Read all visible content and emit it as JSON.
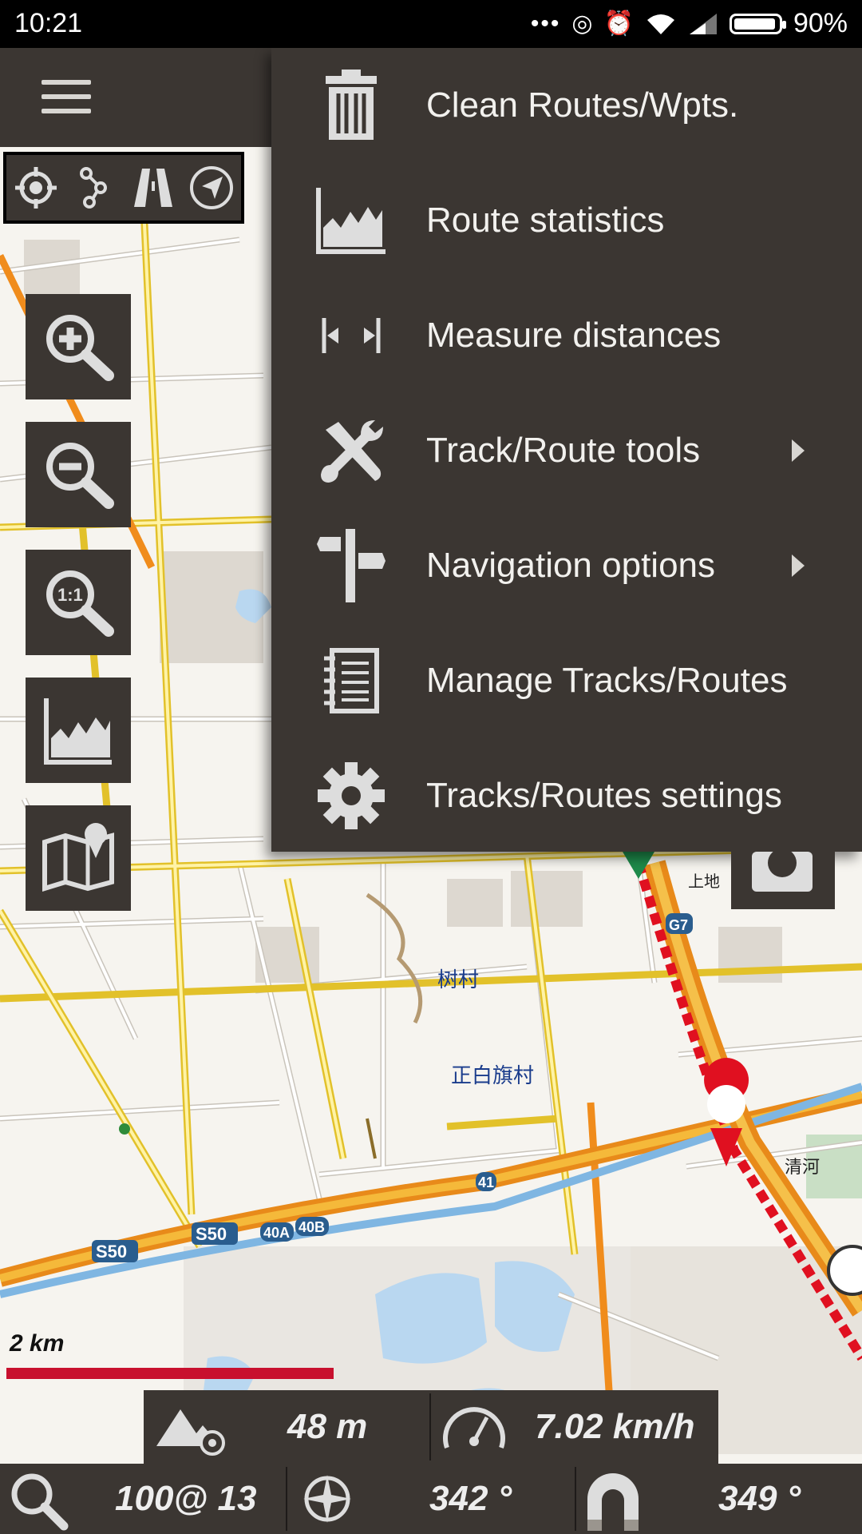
{
  "status_bar": {
    "time": "10:21",
    "battery": "90%"
  },
  "menu": {
    "items": [
      {
        "label": "Clean Routes/Wpts.",
        "icon": "trash-icon",
        "submenu": false
      },
      {
        "label": "Route statistics",
        "icon": "chart-icon",
        "submenu": false
      },
      {
        "label": "Measure distances",
        "icon": "measure-icon",
        "submenu": false
      },
      {
        "label": "Track/Route tools",
        "icon": "tools-icon",
        "submenu": true
      },
      {
        "label": "Navigation options",
        "icon": "signpost-icon",
        "submenu": true
      },
      {
        "label": "Manage Tracks/Routes",
        "icon": "notebook-icon",
        "submenu": false
      },
      {
        "label": "Tracks/Routes settings",
        "icon": "gear-icon",
        "submenu": false
      }
    ]
  },
  "map": {
    "scale_label": "2 km",
    "place_labels": [
      "树村",
      "正白旗村",
      "清河",
      "上地"
    ],
    "road_labels": [
      "S50",
      "S50",
      "40A",
      "40B",
      "41",
      "G7"
    ]
  },
  "stats": {
    "altitude": "48 m",
    "speed": "7.02 km/h",
    "zoom": "100@ 13",
    "bearing": "342 °",
    "heading": "349 °"
  },
  "colors": {
    "panel": "#3b3632",
    "route": "#e01020",
    "scale": "#c8102e"
  }
}
